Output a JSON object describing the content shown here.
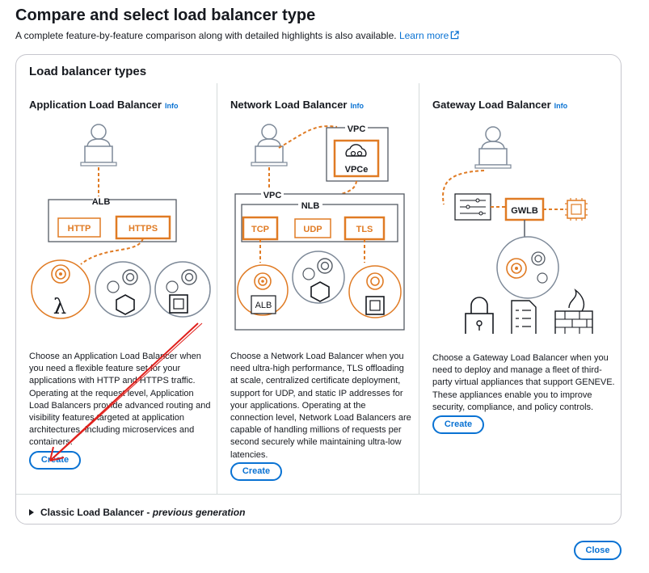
{
  "header": {
    "title": "Compare and select load balancer type",
    "description": "A complete feature-by-feature comparison along with detailed highlights is also available.",
    "learn_more": "Learn more"
  },
  "panel": {
    "title": "Load balancer types",
    "columns": [
      {
        "title": "Application Load Balancer",
        "info": "Info",
        "diagram": {
          "group_label": "ALB",
          "boxes": [
            "HTTP",
            "HTTPS"
          ]
        },
        "description_lines": [
          "Choose an Application Load Balancer when",
          "you need a flexible feature set for your",
          "applications with HTTP and HTTPS traffic.",
          "Operating at the request level, Application",
          "Load Balancers provide advanced routing and",
          "visibility features targeted at application",
          "architectures, including microservices and",
          "containers."
        ],
        "button": "Create"
      },
      {
        "title": "Network Load Balancer",
        "info": "Info",
        "diagram": {
          "vpc_label": "VPC",
          "vpce_label": "VPCe",
          "outer_vpc_label": "VPC",
          "group_label": "NLB",
          "boxes": [
            "TCP",
            "UDP",
            "TLS"
          ],
          "target_label": "ALB"
        },
        "description_lines": [
          "Choose a Network Load Balancer when you",
          "need ultra-high performance, TLS offloading",
          "at scale, centralized certificate deployment,",
          "support for UDP, and static IP addresses for",
          "your applications. Operating at the",
          "connection level, Network Load Balancers are",
          "capable of handling millions of requests per",
          "second securely while maintaining ultra-low",
          "latencies."
        ],
        "button": "Create"
      },
      {
        "title": "Gateway Load Balancer",
        "info": "Info",
        "diagram": {
          "group_label": "GWLB"
        },
        "description_lines": [
          "Choose a Gateway Load Balancer when you",
          "need to deploy and manage a fleet of third-",
          "party virtual appliances that support GENEVE.",
          "These appliances enable you to improve",
          "security, compliance, and policy controls."
        ],
        "button": "Create"
      }
    ],
    "classic": {
      "label": "Classic Load Balancer",
      "suffix": "previous generation"
    }
  },
  "footer": {
    "close": "Close"
  },
  "colors": {
    "accent": "#0972d3",
    "orange": "#e07b24",
    "annotation": "#e0201c"
  }
}
